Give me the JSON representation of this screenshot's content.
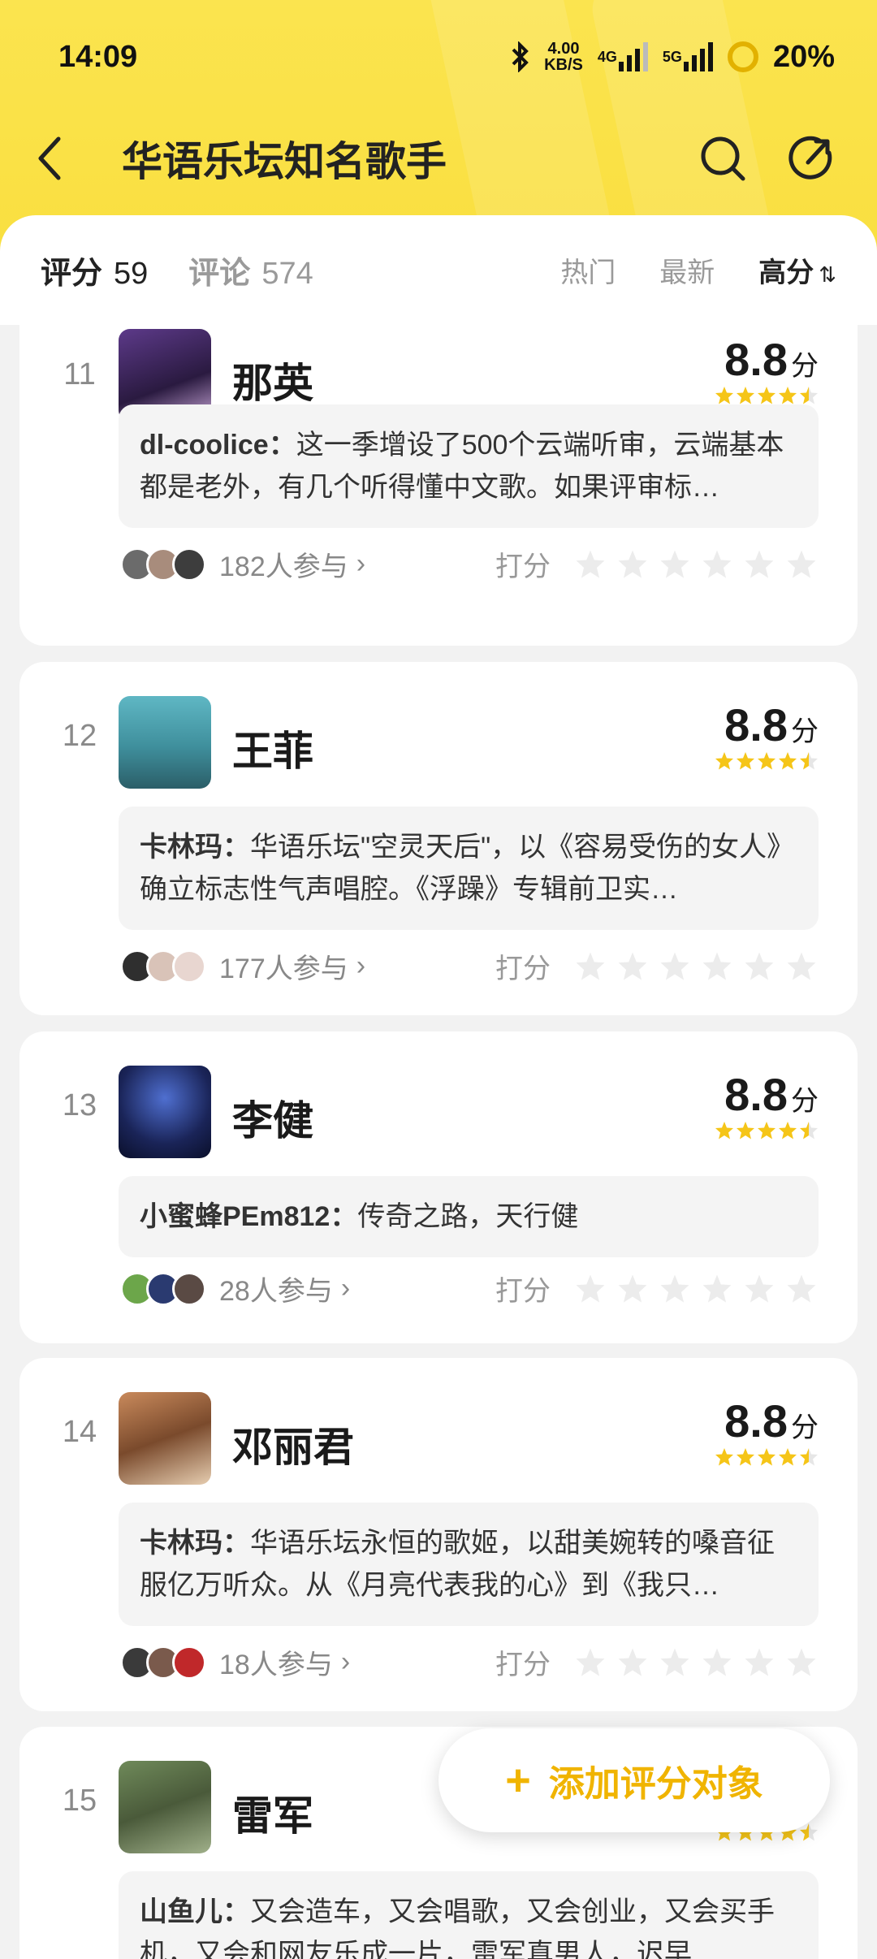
{
  "status": {
    "time": "14:09",
    "speed_top": "4.00",
    "speed_bottom": "KB/S",
    "net1": "4G",
    "net2": "5G",
    "battery": "20%"
  },
  "nav": {
    "title": "华语乐坛知名歌手"
  },
  "tabs": {
    "score_label": "评分",
    "score_count": "59",
    "comment_label": "评论",
    "comment_count": "574",
    "sort_hot": "热门",
    "sort_new": "最新",
    "sort_high": "高分",
    "sort_icon": "⇅"
  },
  "cards": [
    {
      "rank": "11",
      "name": "那英",
      "score": "8.8",
      "unit": "分",
      "user": "dl-coolice：",
      "text": "这一季增设了500个云端听审，云端基本都是老外，有几个听得懂中文歌。如果评审标…",
      "participants": "182人参与",
      "rate_label": "打分"
    },
    {
      "rank": "12",
      "name": "王菲",
      "score": "8.8",
      "unit": "分",
      "user": "卡林玛：",
      "text": "华语乐坛\"空灵天后\"，以《容易受伤的女人》确立标志性气声唱腔。《浮躁》专辑前卫实…",
      "participants": "177人参与",
      "rate_label": "打分"
    },
    {
      "rank": "13",
      "name": "李健",
      "score": "8.8",
      "unit": "分",
      "user": "小蜜蜂PEm812：",
      "text": "传奇之路，天行健",
      "participants": "28人参与",
      "rate_label": "打分"
    },
    {
      "rank": "14",
      "name": "邓丽君",
      "score": "8.8",
      "unit": "分",
      "user": "卡林玛：",
      "text": "华语乐坛永恒的歌姬，以甜美婉转的嗓音征服亿万听众。从《月亮代表我的心》到《我只…",
      "participants": "18人参与",
      "rate_label": "打分"
    },
    {
      "rank": "15",
      "name": "雷军",
      "score": "",
      "unit": "",
      "user": "山鱼儿：",
      "text": "又会造车，又会唱歌，又会创业，又会买手机，又会和网友乐成一片，雷军真男人，迟早…",
      "participants": "",
      "rate_label": ""
    }
  ],
  "add_button": {
    "plus": "+",
    "label": "添加评分对象"
  },
  "colors": {
    "brand_yellow": "#f9df3f",
    "star_yellow": "#f5c518",
    "accent_text": "#f0b400"
  },
  "icons": [
    "back-icon",
    "search-icon",
    "share-icon",
    "bluetooth-icon",
    "signal-icon",
    "battery-icon",
    "star-icon",
    "chevron-right-icon",
    "sort-icon"
  ]
}
